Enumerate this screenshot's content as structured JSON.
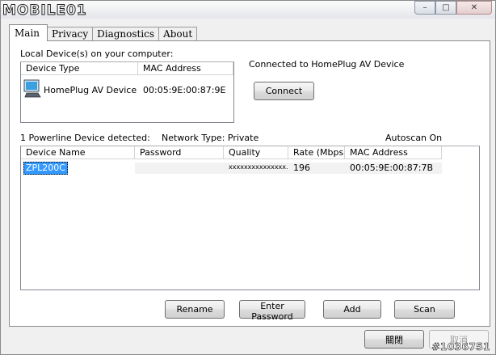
{
  "window": {
    "logo_text": "MOBILE01",
    "controls": {
      "minimize": "–",
      "maximize": "□",
      "close": "✕"
    }
  },
  "tabs": [
    {
      "label": "Main",
      "active": true
    },
    {
      "label": "Privacy",
      "active": false
    },
    {
      "label": "Diagnostics",
      "active": false
    },
    {
      "label": "About",
      "active": false
    }
  ],
  "local": {
    "title": "Local Device(s) on your computer:",
    "columns": [
      "Device Type",
      "MAC Address"
    ],
    "rows": [
      {
        "icon": "computer-monitor-icon",
        "device_type": "HomePlug AV Device",
        "mac": "00:05:9E:00:87:9E"
      }
    ]
  },
  "connection": {
    "status": "Connected to HomePlug AV Device",
    "connect_label": "Connect"
  },
  "status_bar": {
    "detected": "1 Powerline Device detected:",
    "network_type": "Network Type: Private",
    "autoscan": "Autoscan On"
  },
  "remote": {
    "columns": [
      "Device Name",
      "Password",
      "Quality",
      "Rate (Mbps)",
      "MAC Address"
    ],
    "rows": [
      {
        "name": "ZPL200C",
        "password": "",
        "quality": "xxxxxxxxxxxxxxx...",
        "rate": "196",
        "mac": "00:05:9E:00:87:7B"
      }
    ]
  },
  "actions": {
    "rename": "Rename",
    "enter_password": "Enter Password",
    "add": "Add",
    "scan": "Scan"
  },
  "footer": {
    "close_label": "關閉",
    "cancel_label": "取消"
  },
  "watermark": "#1036751",
  "colors": {
    "selection": "#3399ff",
    "panel_bg": "#f0f0f0"
  }
}
